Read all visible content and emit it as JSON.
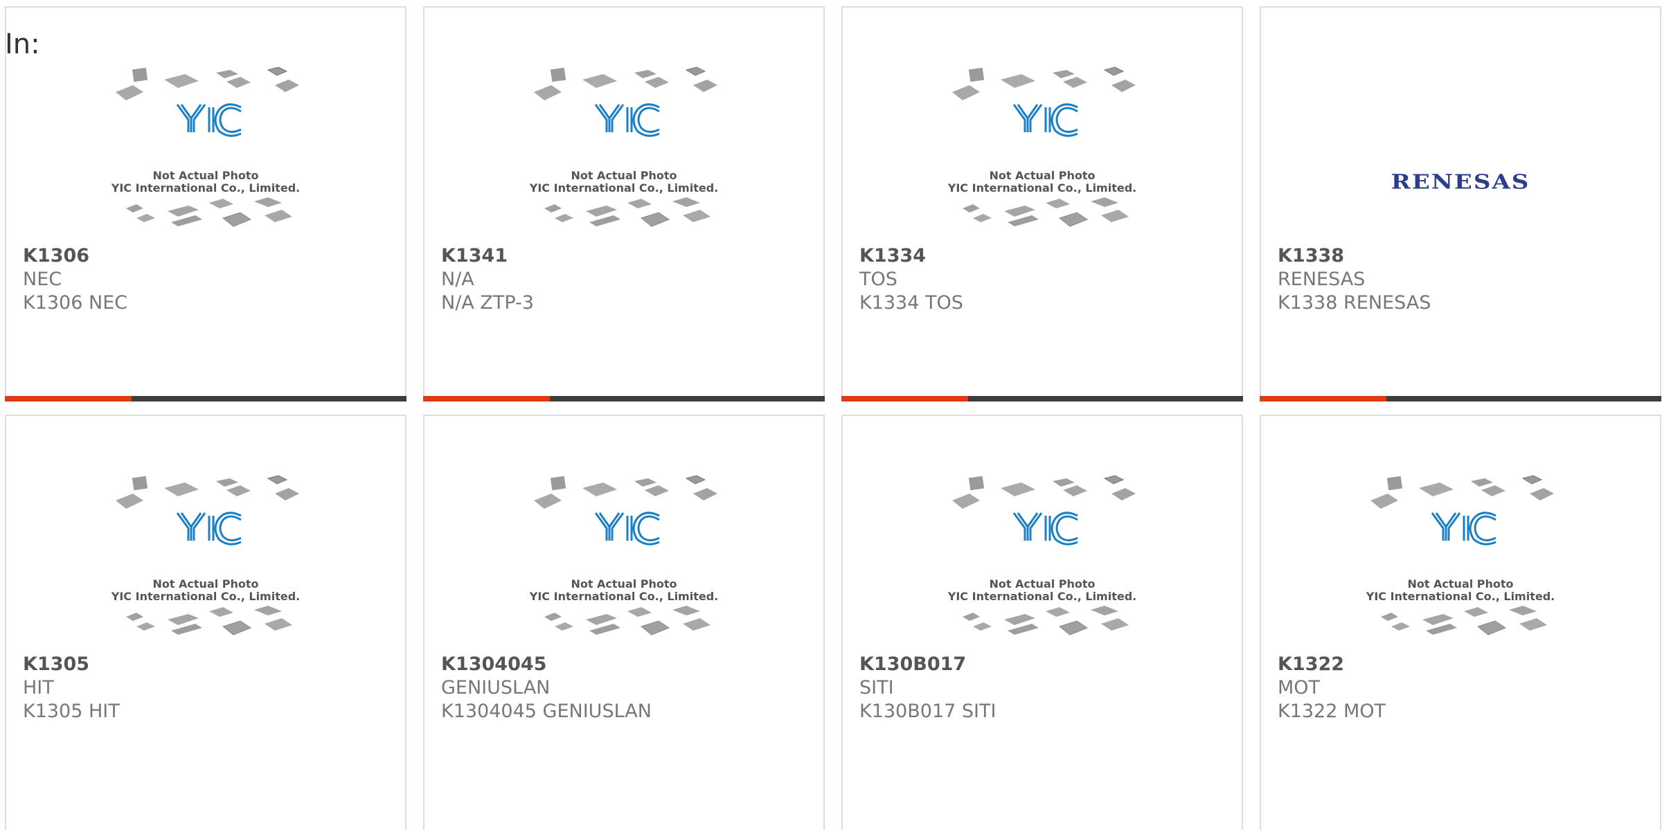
{
  "header": {
    "label": "In:"
  },
  "watermark": {
    "line1": "Not Actual Photo",
    "line2": "YIC International Co., Limited.",
    "logo_text": "YIC"
  },
  "colors": {
    "accent": "#e03a12",
    "bar": "#3d3d3d",
    "yic_blue": "#1b7fc4",
    "renesas_blue": "#2a3d8f"
  },
  "products": [
    {
      "part": "K1306",
      "maker": "NEC",
      "desc": "K1306 NEC",
      "image": "yic-placeholder"
    },
    {
      "part": "K1341",
      "maker": "N/A",
      "desc": "N/A ZTP-3",
      "image": "yic-placeholder"
    },
    {
      "part": "K1334",
      "maker": "TOS",
      "desc": "K1334 TOS",
      "image": "yic-placeholder"
    },
    {
      "part": "K1338",
      "maker": "RENESAS",
      "desc": "K1338 RENESAS",
      "image": "renesas-logo",
      "logo_text": "RENESAS"
    },
    {
      "part": "K1305",
      "maker": "HIT",
      "desc": "K1305 HIT",
      "image": "yic-placeholder"
    },
    {
      "part": "K1304045",
      "maker": "GENIUSLAN",
      "desc": "K1304045 GENIUSLAN",
      "image": "yic-placeholder"
    },
    {
      "part": "K130B017",
      "maker": "SITI",
      "desc": "K130B017 SITI",
      "image": "yic-placeholder"
    },
    {
      "part": "K1322",
      "maker": "MOT",
      "desc": "K1322 MOT",
      "image": "yic-placeholder"
    }
  ]
}
